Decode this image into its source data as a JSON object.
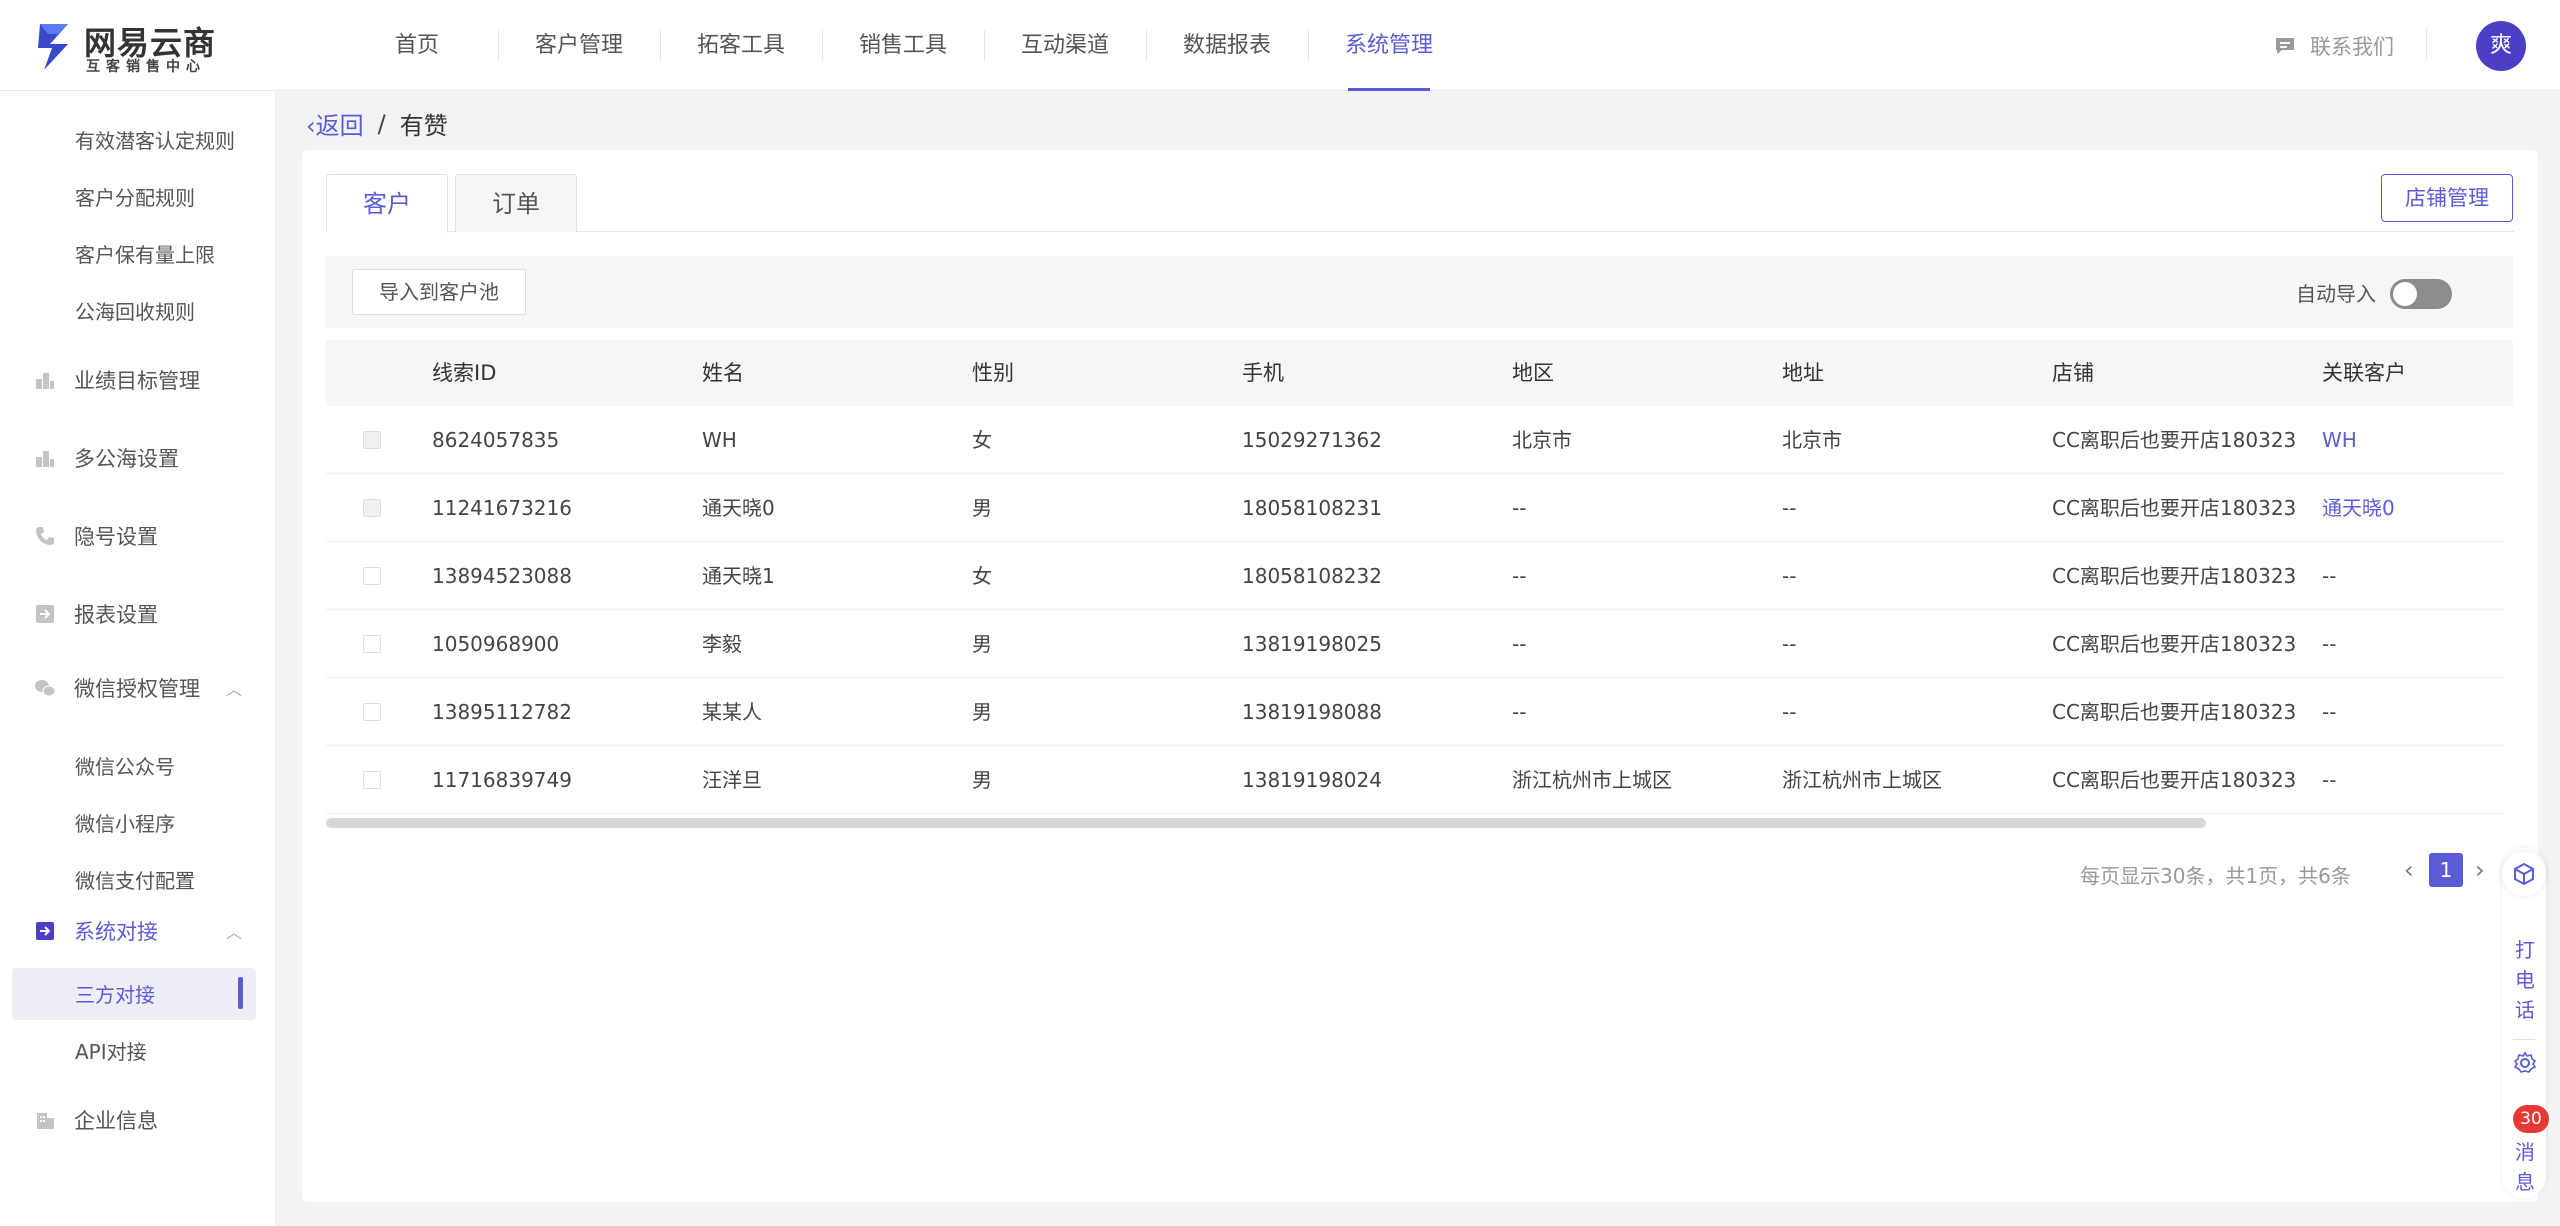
{
  "brand": {
    "name": "网易云商",
    "subtitle": "互客销售中心"
  },
  "nav": {
    "items": [
      "首页",
      "客户管理",
      "拓客工具",
      "销售工具",
      "互动渠道",
      "数据报表",
      "系统管理"
    ],
    "active_index": 6
  },
  "header": {
    "contact": "联系我们",
    "avatar_text": "爽"
  },
  "sidebar": {
    "top_subitems": [
      "有效潜客认定规则",
      "客户分配规则",
      "客户保有量上限",
      "公海回收规则"
    ],
    "groups": {
      "performance": "业绩目标管理",
      "multi_pool": "多公海设置",
      "privacy": "隐号设置",
      "report": "报表设置",
      "wechat": "微信授权管理",
      "system": "系统对接",
      "enterprise": "企业信息"
    },
    "wechat_items": [
      "微信公众号",
      "微信小程序",
      "微信支付配置"
    ],
    "system_items": [
      "三方对接",
      "API对接"
    ]
  },
  "breadcrumb": {
    "back": "返回",
    "separator": "/",
    "current": "有赞"
  },
  "tabs": [
    "客户",
    "订单"
  ],
  "store_button": "店铺管理",
  "toolbar": {
    "import_button": "导入到客户池",
    "auto_import_label": "自动导入",
    "auto_import_on": false
  },
  "table": {
    "columns": [
      "线索ID",
      "姓名",
      "性别",
      "手机",
      "地区",
      "地址",
      "店铺",
      "关联客户"
    ],
    "rows": [
      [
        "8624057835",
        "WH",
        "女",
        "15029271362",
        "北京市",
        "北京市",
        "CC离职后也要开店180323",
        "WH"
      ],
      [
        "11241673216",
        "通天晓0",
        "男",
        "18058108231",
        "--",
        "--",
        "CC离职后也要开店180323",
        "通天晓0"
      ],
      [
        "13894523088",
        "通天晓1",
        "女",
        "18058108232",
        "--",
        "--",
        "CC离职后也要开店180323",
        "--"
      ],
      [
        "1050968900",
        "李毅",
        "男",
        "13819198025",
        "--",
        "--",
        "CC离职后也要开店180323",
        "--"
      ],
      [
        "13895112782",
        "某某人",
        "男",
        "13819198088",
        "--",
        "--",
        "CC离职后也要开店180323",
        "--"
      ],
      [
        "11716839749",
        "汪洋旦",
        "男",
        "13819198024",
        "浙江杭州市上城区",
        "浙江杭州市上城区",
        "CC离职后也要开店180323",
        "--"
      ]
    ]
  },
  "pagination": {
    "info": "每页显示30条，共1页，共6条",
    "current_page": "1"
  },
  "float": {
    "call": [
      "打",
      "电",
      "话"
    ],
    "message": [
      "消",
      "息"
    ],
    "badge": "30"
  },
  "colors": {
    "accent": "#5b5bd6",
    "badge": "#e53935"
  }
}
